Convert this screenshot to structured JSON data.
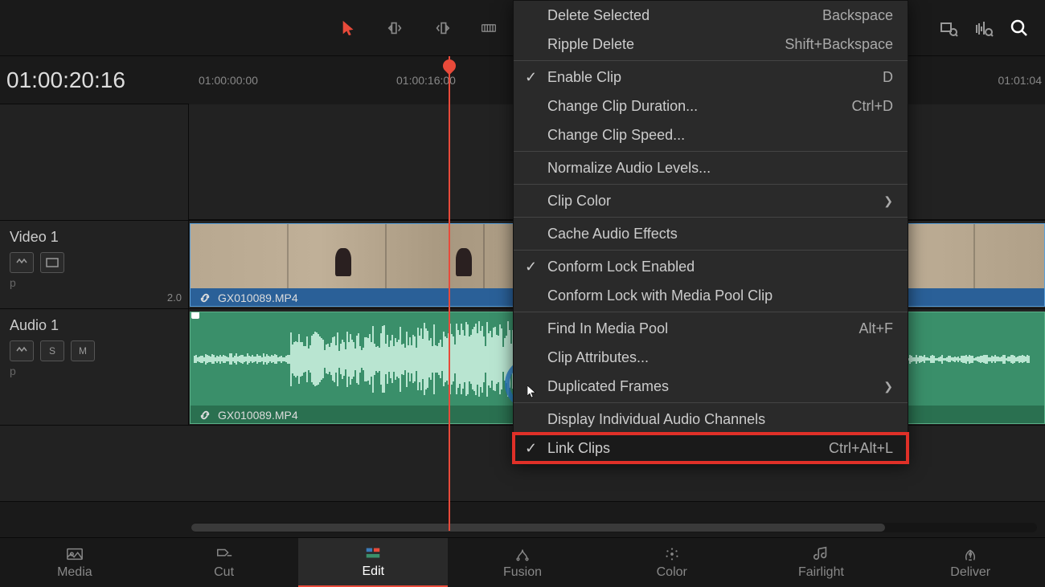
{
  "timecode": "01:00:20:16",
  "ruler": {
    "t1": "01:00:00:00",
    "t2": "01:00:16:00",
    "t3": "01:01:04"
  },
  "tracks": {
    "video": {
      "name": "Video 1",
      "clip": "GX010089.MP4"
    },
    "audio": {
      "name": "Audio 1",
      "clip": "GX010089.MP4",
      "channels": "2.0"
    }
  },
  "menu": {
    "delete_selected": {
      "label": "Delete Selected",
      "shortcut": "Backspace"
    },
    "ripple_delete": {
      "label": "Ripple Delete",
      "shortcut": "Shift+Backspace"
    },
    "enable_clip": {
      "label": "Enable Clip",
      "shortcut": "D"
    },
    "change_duration": {
      "label": "Change Clip Duration...",
      "shortcut": "Ctrl+D"
    },
    "change_speed": {
      "label": "Change Clip Speed..."
    },
    "normalize": {
      "label": "Normalize Audio Levels..."
    },
    "clip_color": {
      "label": "Clip Color"
    },
    "cache_audio": {
      "label": "Cache Audio Effects"
    },
    "conform_lock": {
      "label": "Conform Lock Enabled"
    },
    "conform_pool": {
      "label": "Conform Lock with Media Pool Clip"
    },
    "find_media": {
      "label": "Find In Media Pool",
      "shortcut": "Alt+F"
    },
    "clip_attrs": {
      "label": "Clip Attributes..."
    },
    "dup_frames": {
      "label": "Duplicated Frames"
    },
    "display_channels": {
      "label": "Display Individual Audio Channels"
    },
    "link_clips": {
      "label": "Link Clips",
      "shortcut": "Ctrl+Alt+L"
    }
  },
  "nav": {
    "media": "Media",
    "cut": "Cut",
    "edit": "Edit",
    "fusion": "Fusion",
    "color": "Color",
    "fairlight": "Fairlight",
    "deliver": "Deliver"
  },
  "track_btns": {
    "s": "S",
    "m": "M",
    "p": "p"
  }
}
